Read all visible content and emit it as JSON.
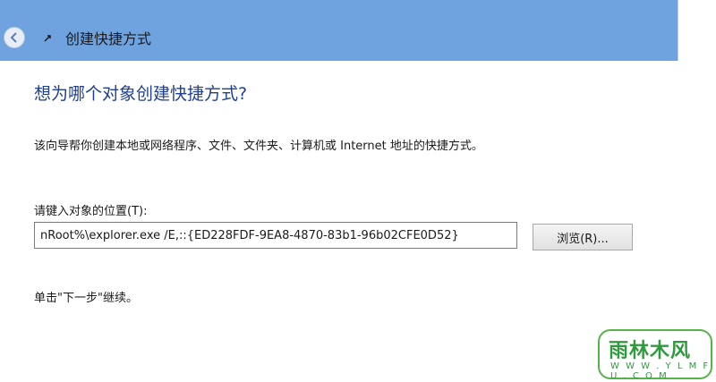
{
  "window": {
    "title": "创建快捷方式"
  },
  "main": {
    "heading": "想为哪个对象创建快捷方式?",
    "description": "该向导帮你创建本地或网络程序、文件、文件夹、计算机或 Internet 地址的快捷方式。",
    "location_label": "请键入对象的位置(T):",
    "location_value": "nRoot%\\explorer.exe /E,::{ED228FDF-9EA8-4870-83b1-96b02CFE0D52}",
    "browse_label": "浏览(R)...",
    "hint": "单击\"下一步\"继续。"
  },
  "watermark": {
    "text": "雨林木风",
    "url": "W W W . Y L M F U . C O M"
  },
  "icons": {
    "back": "back-arrow-icon",
    "app": "shortcut-icon"
  },
  "colors": {
    "titlebar": "#6fa3e0",
    "heading": "#1f3f8f",
    "watermark": "#2f9a3e"
  }
}
